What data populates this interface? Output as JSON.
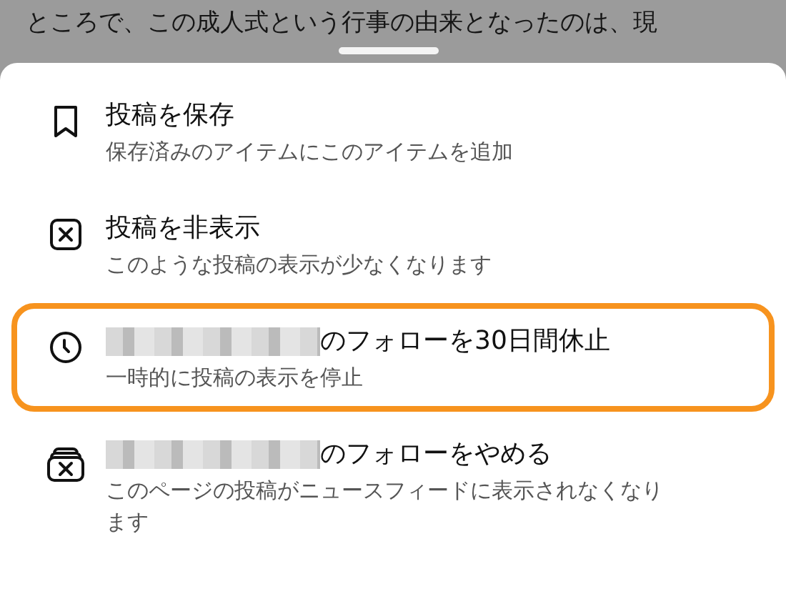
{
  "background_post": {
    "lines": [
      "ところで、この成人式という行事の由来となったのは、現"
    ]
  },
  "sheet": {
    "items": [
      {
        "kind": "bookmark",
        "title_prefix_redacted": false,
        "title": "投稿を保存",
        "subtitle": "保存済みのアイテムにこのアイテムを追加",
        "highlighted": false
      },
      {
        "kind": "hide",
        "title_prefix_redacted": false,
        "title": "投稿を非表示",
        "subtitle": "このような投稿の表示が少なくなります",
        "highlighted": false
      },
      {
        "kind": "snooze",
        "title_prefix_redacted": true,
        "title": "のフォローを30日間休止",
        "subtitle": "一時的に投稿の表示を停止",
        "highlighted": true
      },
      {
        "kind": "unfollow",
        "title_prefix_redacted": true,
        "title": "のフォローをやめる",
        "subtitle": "このページの投稿がニュースフィードに表示されなくなります",
        "highlighted": false
      }
    ]
  }
}
